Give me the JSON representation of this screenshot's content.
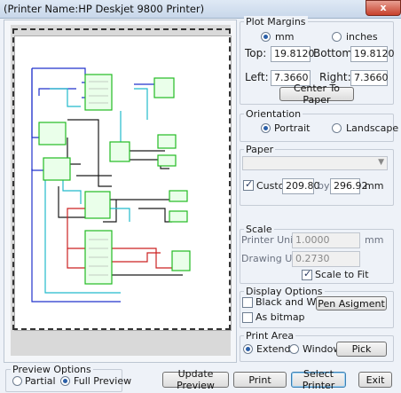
{
  "window": {
    "title": "(Printer Name:HP Deskjet 9800 Printer)",
    "close_label": "x"
  },
  "plot_margins": {
    "title": "Plot Margins",
    "unit_mm": "mm",
    "unit_inches": "inches",
    "top_label": "Top:",
    "top_value": "19.8120",
    "bottom_label": "Bottom:",
    "bottom_value": "19.8120",
    "left_label": "Left:",
    "left_value": "7.3660",
    "right_label": "Right:",
    "right_value": "7.3660",
    "center_button": "Center To Paper"
  },
  "orientation": {
    "title": "Orientation",
    "portrait": "Portrait",
    "landscape": "Landscape"
  },
  "paper": {
    "title": "Paper",
    "selected": "",
    "custom_label": "Custom",
    "width": "209.80",
    "by": "by",
    "height": "296.92",
    "unit": "mm"
  },
  "scale": {
    "title": "Scale",
    "printer_units_label": "Printer Units:",
    "printer_units_value": "1.0000",
    "printer_units_unit": "mm",
    "drawing_units_label": "Drawing Units:",
    "drawing_units_value": "0.2730",
    "scale_to_fit": "Scale to Fit"
  },
  "display_options": {
    "title": "Display Options",
    "black_and_white": "Black and White",
    "pen_button": "Pen Asigment",
    "as_bitmap": "As bitmap"
  },
  "print_area": {
    "title": "Print Area",
    "extends": "Extends",
    "window": "Window",
    "pick_button": "Pick"
  },
  "preview_options": {
    "title": "Preview Options",
    "partial": "Partial",
    "full": "Full Preview"
  },
  "footer": {
    "update_preview": "Update Preview",
    "print": "Print",
    "select_printer": "Select Printer",
    "exit": "Exit"
  }
}
